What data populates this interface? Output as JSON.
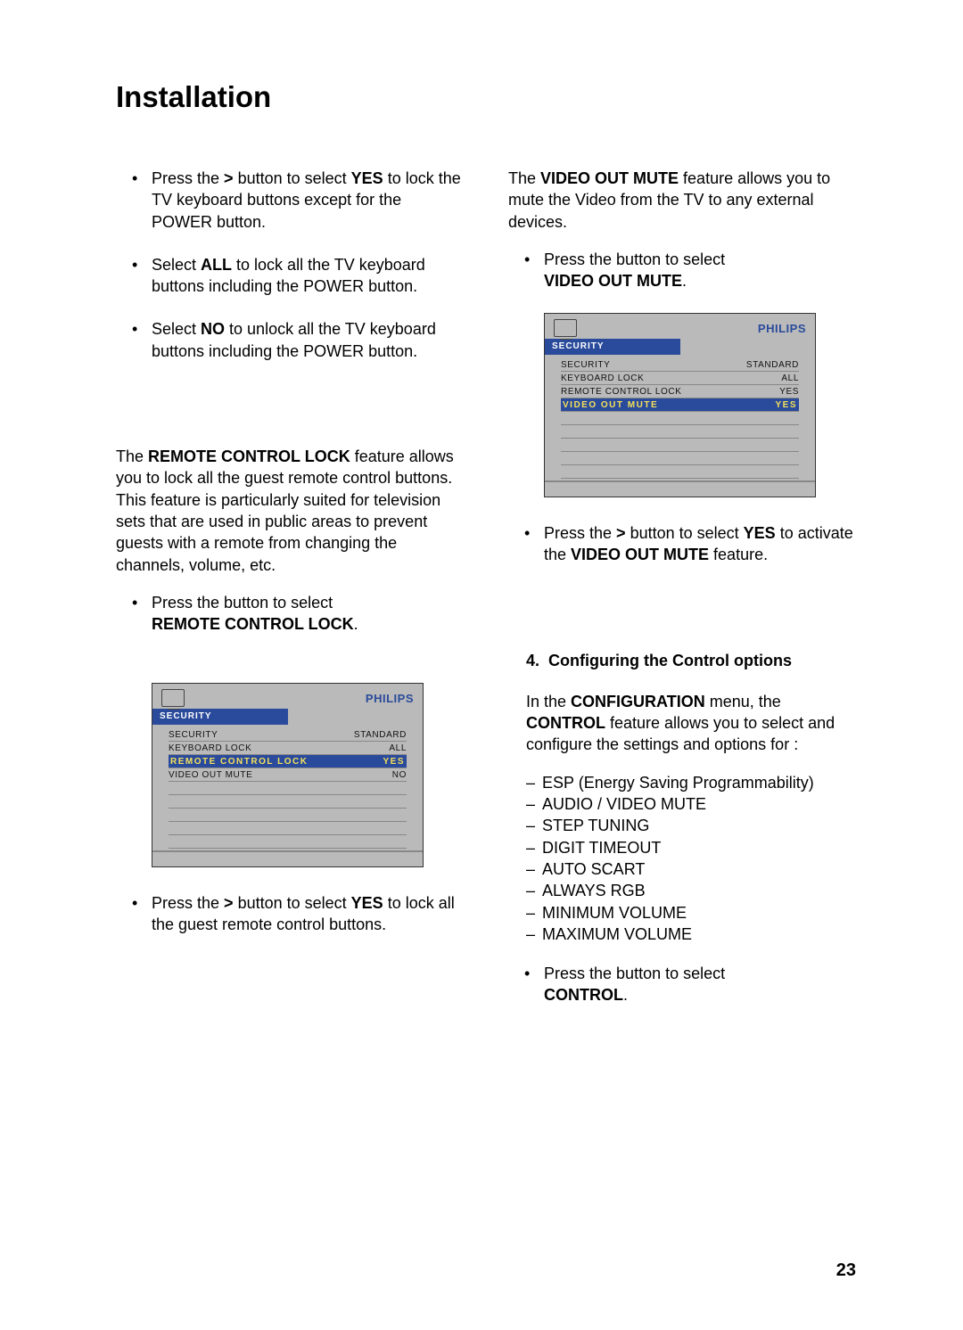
{
  "page_title": "Installation",
  "page_number": "23",
  "left_col": {
    "bullets1": {
      "b1_pre": "Press the ",
      "b1_btn": ">",
      "b1_mid": " button to select ",
      "b1_bold": "YES",
      "b1_rest": " to lock the TV keyboard buttons except for the POWER button.",
      "b2_pre": "Select ",
      "b2_bold": "ALL",
      "b2_rest": " to lock all the TV keyboard buttons including the POWER button.",
      "b3_pre": "Select ",
      "b3_bold": "NO",
      "b3_rest": " to unlock all the TV keyboard buttons including the POWER button."
    },
    "rcl_para_pre": "The ",
    "rcl_para_bold": "REMOTE CONTROL LOCK",
    "rcl_para_rest": " feature allows you to lock all the guest remote control buttons. This feature is particularly suited for television sets that are used in public areas to prevent guests with a remote from changing the channels, volume, etc.",
    "rcl_bullet_pre": "Press the  ",
    "rcl_bullet_mid": " button to select",
    "rcl_bullet_bold": "REMOTE CONTROL LOCK",
    "rcl_bullet_dot": ".",
    "osd1": {
      "brand": "PHILIPS",
      "tab": "SECURITY",
      "rows": [
        {
          "label": "SECURITY",
          "val": "STANDARD"
        },
        {
          "label": "KEYBOARD LOCK",
          "val": "ALL"
        },
        {
          "label": "REMOTE CONTROL LOCK",
          "val": "YES",
          "selected": true
        },
        {
          "label": "VIDEO OUT MUTE",
          "val": "NO"
        }
      ]
    },
    "after_osd1_pre": "Press the ",
    "after_osd1_btn": ">",
    "after_osd1_mid": " button to select ",
    "after_osd1_bold": "YES",
    "after_osd1_rest": " to lock all the guest remote control buttons."
  },
  "right_col": {
    "vom_para_pre": "The ",
    "vom_para_bold": "VIDEO OUT MUTE",
    "vom_para_rest": " feature allows you to mute the Video from the TV to any external devices.",
    "vom_bullet_pre": "Press the  ",
    "vom_bullet_mid": " button to select",
    "vom_bullet_bold": "VIDEO OUT MUTE",
    "vom_bullet_dot": ".",
    "osd2": {
      "brand": "PHILIPS",
      "tab": "SECURITY",
      "rows": [
        {
          "label": "SECURITY",
          "val": "STANDARD"
        },
        {
          "label": "KEYBOARD LOCK",
          "val": "ALL"
        },
        {
          "label": "REMOTE CONTROL LOCK",
          "val": "YES"
        },
        {
          "label": "VIDEO OUT MUTE",
          "val": "YES",
          "selected": true
        }
      ]
    },
    "after_osd2_pre": "Press the ",
    "after_osd2_btn": ">",
    "after_osd2_mid": " button to select ",
    "after_osd2_bold": "YES",
    "after_osd2_mid2": " to activate the ",
    "after_osd2_bold2": "VIDEO OUT MUTE",
    "after_osd2_rest": " feature.",
    "section4_num": "4.",
    "section4_title": "Configuring the Control options",
    "cfg_para_pre": "In the ",
    "cfg_para_bold1": "CONFIGURATION",
    "cfg_para_mid": " menu, the ",
    "cfg_para_bold2": "CONTROL",
    "cfg_para_rest": " feature allows you to select and configure the settings and options for :",
    "dash_items": [
      "ESP (Energy Saving Programmability)",
      "AUDIO / VIDEO MUTE",
      "STEP TUNING",
      "DIGIT TIMEOUT",
      "AUTO SCART",
      "ALWAYS RGB",
      "MINIMUM VOLUME",
      "MAXIMUM VOLUME"
    ],
    "ctrl_bullet_pre": "Press the  ",
    "ctrl_bullet_mid": " button to select",
    "ctrl_bullet_bold": "CONTROL",
    "ctrl_bullet_dot": "."
  }
}
